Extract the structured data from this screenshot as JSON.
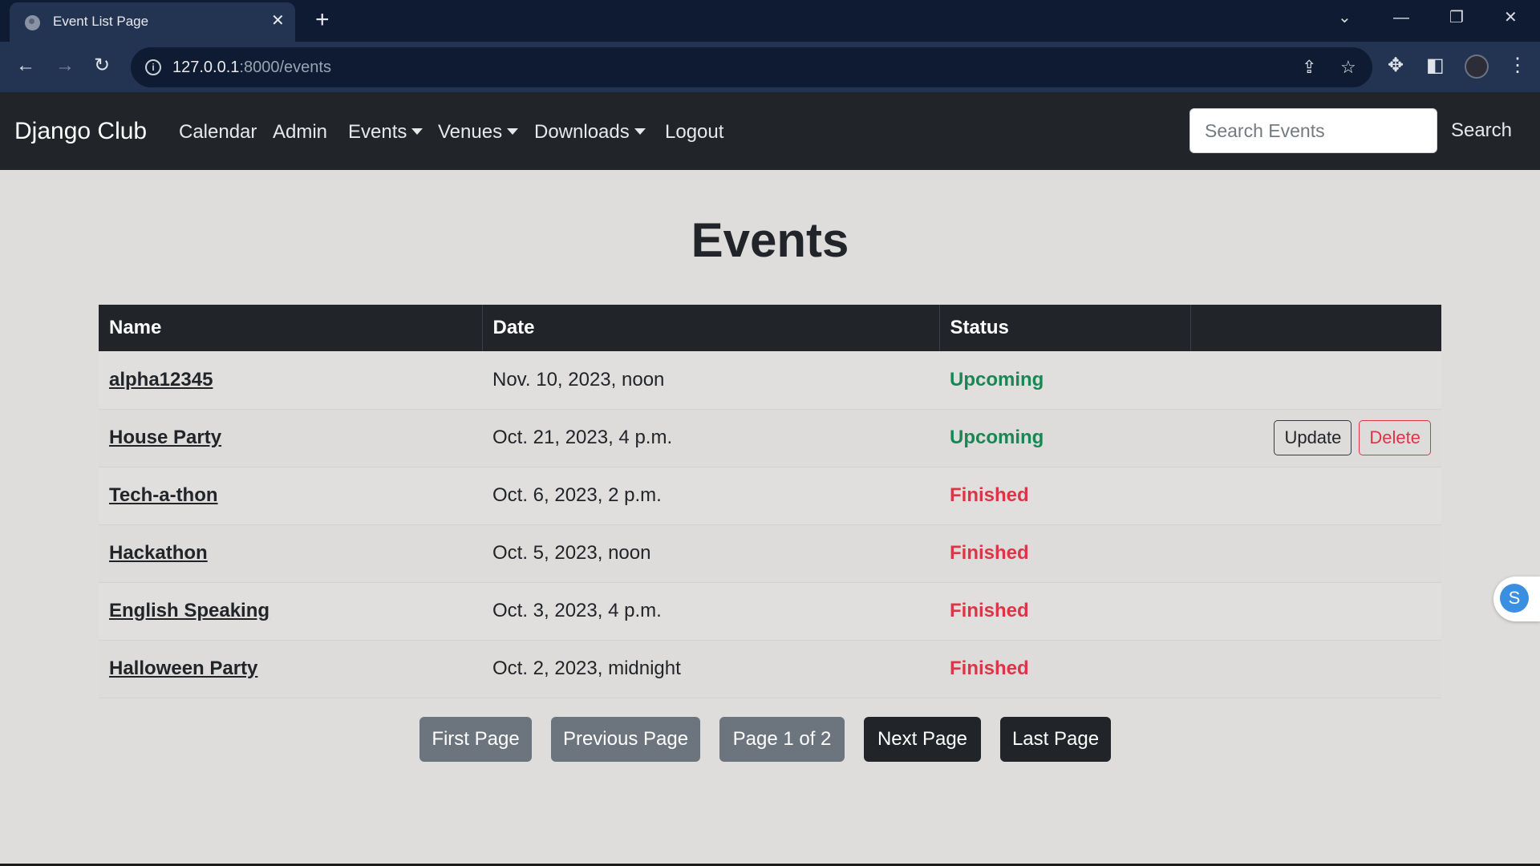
{
  "browser": {
    "tab_title": "Event List Page",
    "url_host": "127.0.0.1",
    "url_rest": ":8000/events"
  },
  "navbar": {
    "brand": "Django Club",
    "links": [
      {
        "label": "Calendar",
        "dropdown": false
      },
      {
        "label": "Admin",
        "dropdown": false
      },
      {
        "label": "Events",
        "dropdown": true
      },
      {
        "label": "Venues",
        "dropdown": true
      },
      {
        "label": "Downloads",
        "dropdown": true
      },
      {
        "label": "Logout",
        "dropdown": false
      }
    ],
    "search_placeholder": "Search Events",
    "search_button": "Search"
  },
  "main": {
    "title": "Events",
    "columns": [
      "Name",
      "Date",
      "Status",
      ""
    ],
    "rows": [
      {
        "name": "alpha12345",
        "date": "Nov. 10, 2023, noon",
        "status": "Upcoming",
        "status_type": "upcoming",
        "actions": false
      },
      {
        "name": "House Party",
        "date": "Oct. 21, 2023, 4 p.m.",
        "status": "Upcoming",
        "status_type": "upcoming",
        "actions": true
      },
      {
        "name": "Tech-a-thon",
        "date": "Oct. 6, 2023, 2 p.m.",
        "status": "Finished",
        "status_type": "finished",
        "actions": false
      },
      {
        "name": "Hackathon",
        "date": "Oct. 5, 2023, noon",
        "status": "Finished",
        "status_type": "finished",
        "actions": false
      },
      {
        "name": "English Speaking",
        "date": "Oct. 3, 2023, 4 p.m.",
        "status": "Finished",
        "status_type": "finished",
        "actions": false
      },
      {
        "name": "Halloween Party",
        "date": "Oct. 2, 2023, midnight",
        "status": "Finished",
        "status_type": "finished",
        "actions": false
      }
    ],
    "update_label": "Update",
    "delete_label": "Delete"
  },
  "pagination": {
    "first": "First Page",
    "previous": "Previous Page",
    "current": "Page 1 of 2",
    "next": "Next Page",
    "last": "Last Page"
  },
  "side_widget": {
    "letter": "S"
  },
  "colors": {
    "navbar_bg": "#212529",
    "upcoming": "#198754",
    "finished": "#dc3545",
    "page_bg": "#dfdcdc"
  }
}
